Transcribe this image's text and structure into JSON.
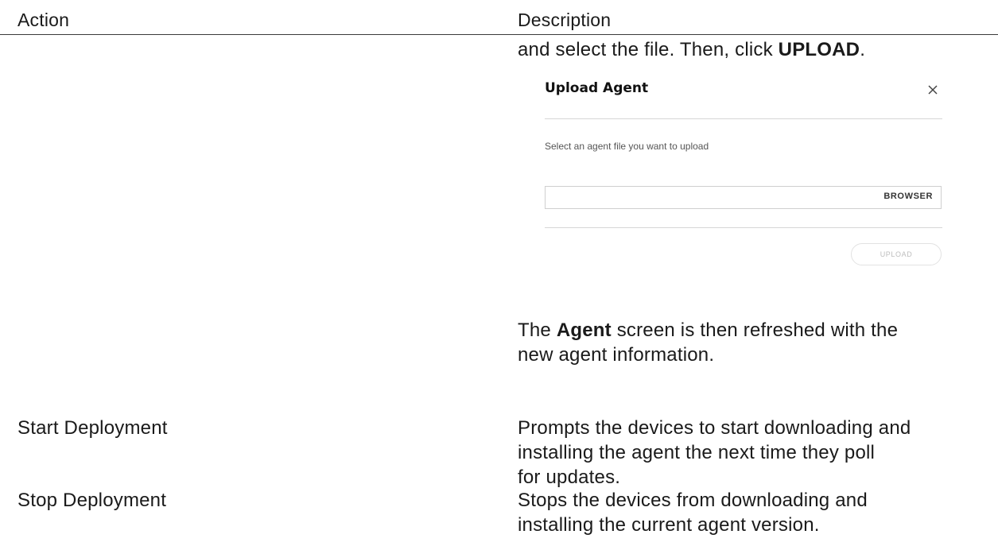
{
  "table": {
    "headers": {
      "action": "Action",
      "description": "Description"
    }
  },
  "upload_row": {
    "instruction_prefix": "and select the file. Then, click ",
    "instruction_bold": "UPLOAD",
    "instruction_suffix": ".",
    "dialog": {
      "title": "Upload Agent",
      "close_icon": "close-icon",
      "prompt": "Select an agent file you want to upload",
      "file_value": "",
      "browse_label": "BROWSER",
      "upload_label": "UPLOAD"
    },
    "result_prefix": "The ",
    "result_bold": "Agent",
    "result_line1_suffix": " screen is then refreshed with the",
    "result_line2": "new agent information."
  },
  "rows": [
    {
      "action": "Start Deployment",
      "description_lines": [
        "Prompts the devices to start downloading and",
        "installing the agent the next time they poll",
        "for updates."
      ]
    },
    {
      "action": "Stop Deployment",
      "description_lines": [
        "Stops the devices from downloading and",
        "installing the current agent version."
      ]
    }
  ]
}
